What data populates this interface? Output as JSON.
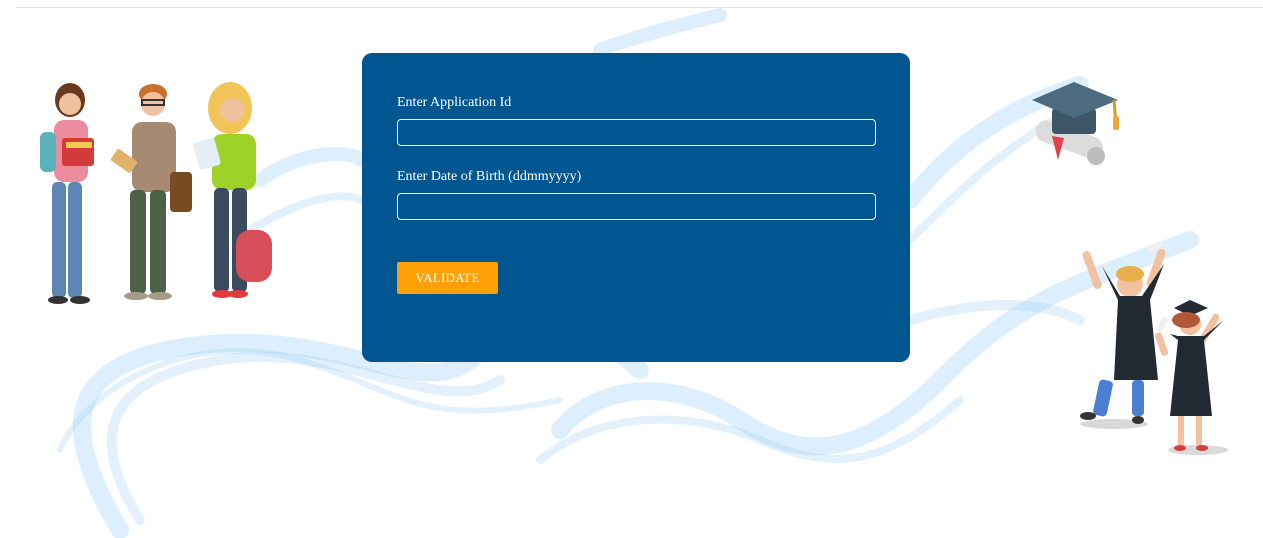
{
  "form": {
    "application_id_label": "Enter Application Id",
    "application_id_value": "",
    "dob_label": "Enter Date of Birth (ddmmyyyy)",
    "dob_value": "",
    "validate_label": "VALIDATE"
  },
  "colors": {
    "card_background": "#005691",
    "button_background": "#ffa007",
    "wave": "#9fd0f5"
  },
  "icons": {
    "left_illustration": "students-group-illustration",
    "top_right_illustration": "graduation-cap-diploma-illustration",
    "bottom_right_illustration": "graduates-celebrating-illustration"
  }
}
